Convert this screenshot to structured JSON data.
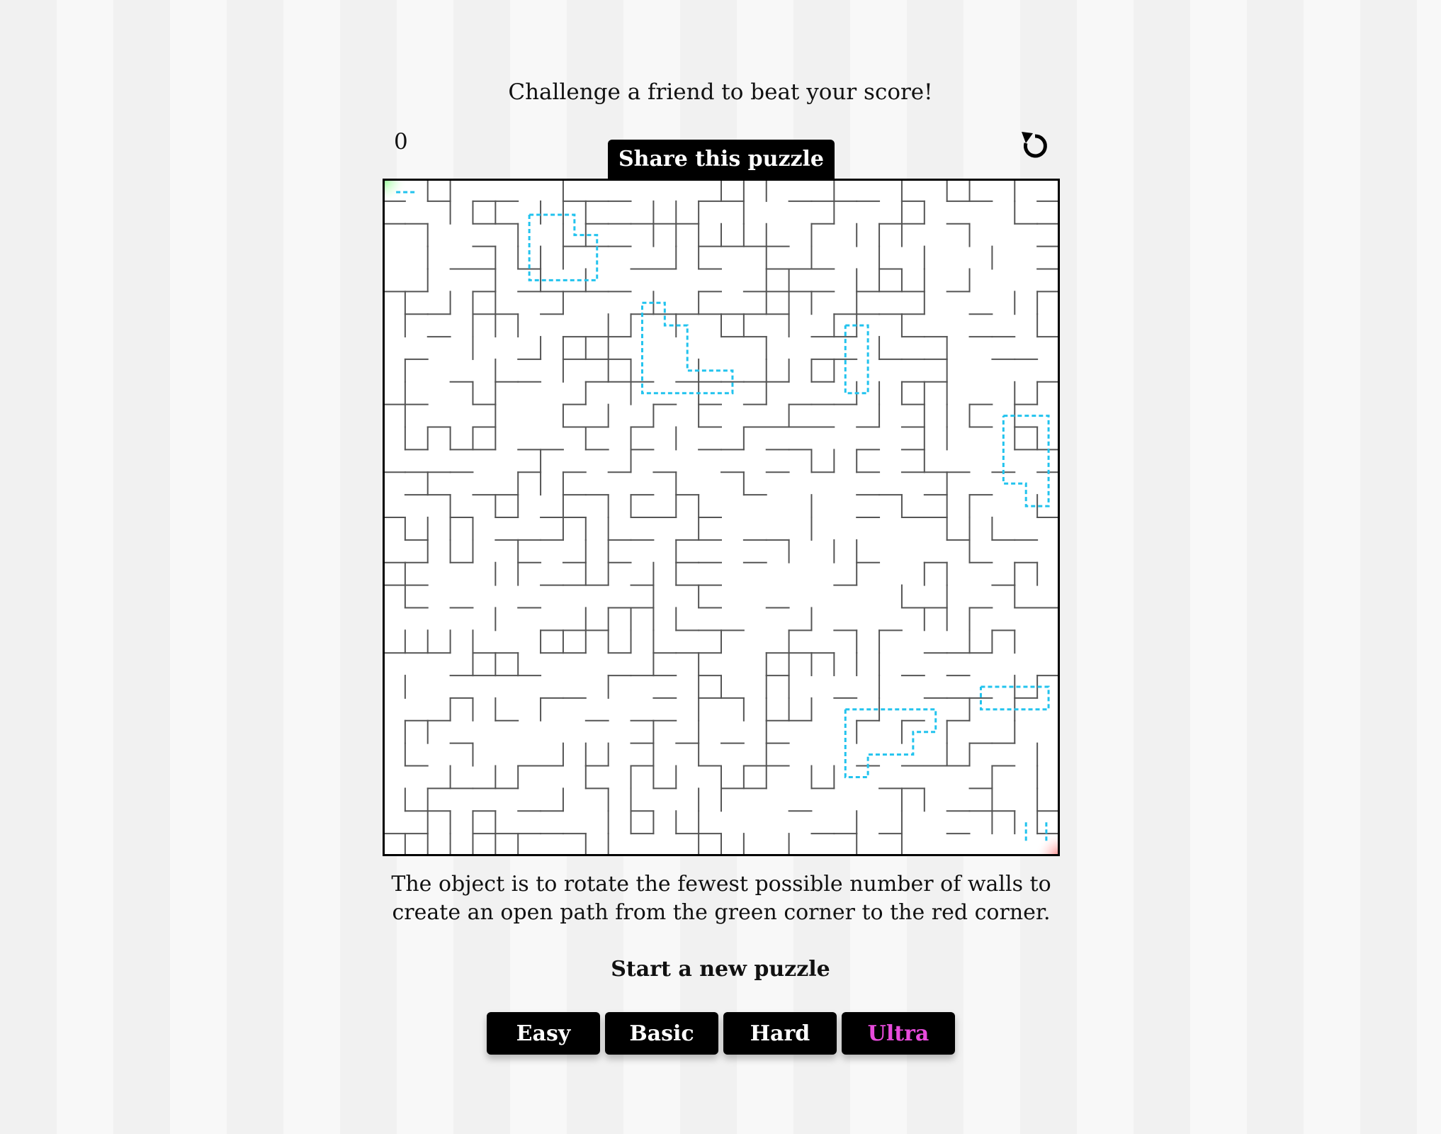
{
  "header": {
    "challenge_text": "Challenge a friend to beat your score!",
    "score": "0",
    "share_label": "Share this puzzle",
    "reset_icon": "↺"
  },
  "board": {
    "grid_size": 30,
    "start_corner": "top-left",
    "end_corner": "bottom-right",
    "start_color": "#7fff7f",
    "end_color": "#ff7f7f",
    "wall_color": "#555555",
    "highlight_color": "#22c3ee"
  },
  "description": "The object is to rotate the fewest possible number of walls to create an open path from the green corner to the red corner.",
  "new_puzzle": {
    "title": "Start a new puzzle",
    "levels": [
      {
        "label": "Easy"
      },
      {
        "label": "Basic"
      },
      {
        "label": "Hard"
      },
      {
        "label": "Ultra"
      }
    ],
    "active_level": "Ultra",
    "active_color": "#e84bdc"
  }
}
